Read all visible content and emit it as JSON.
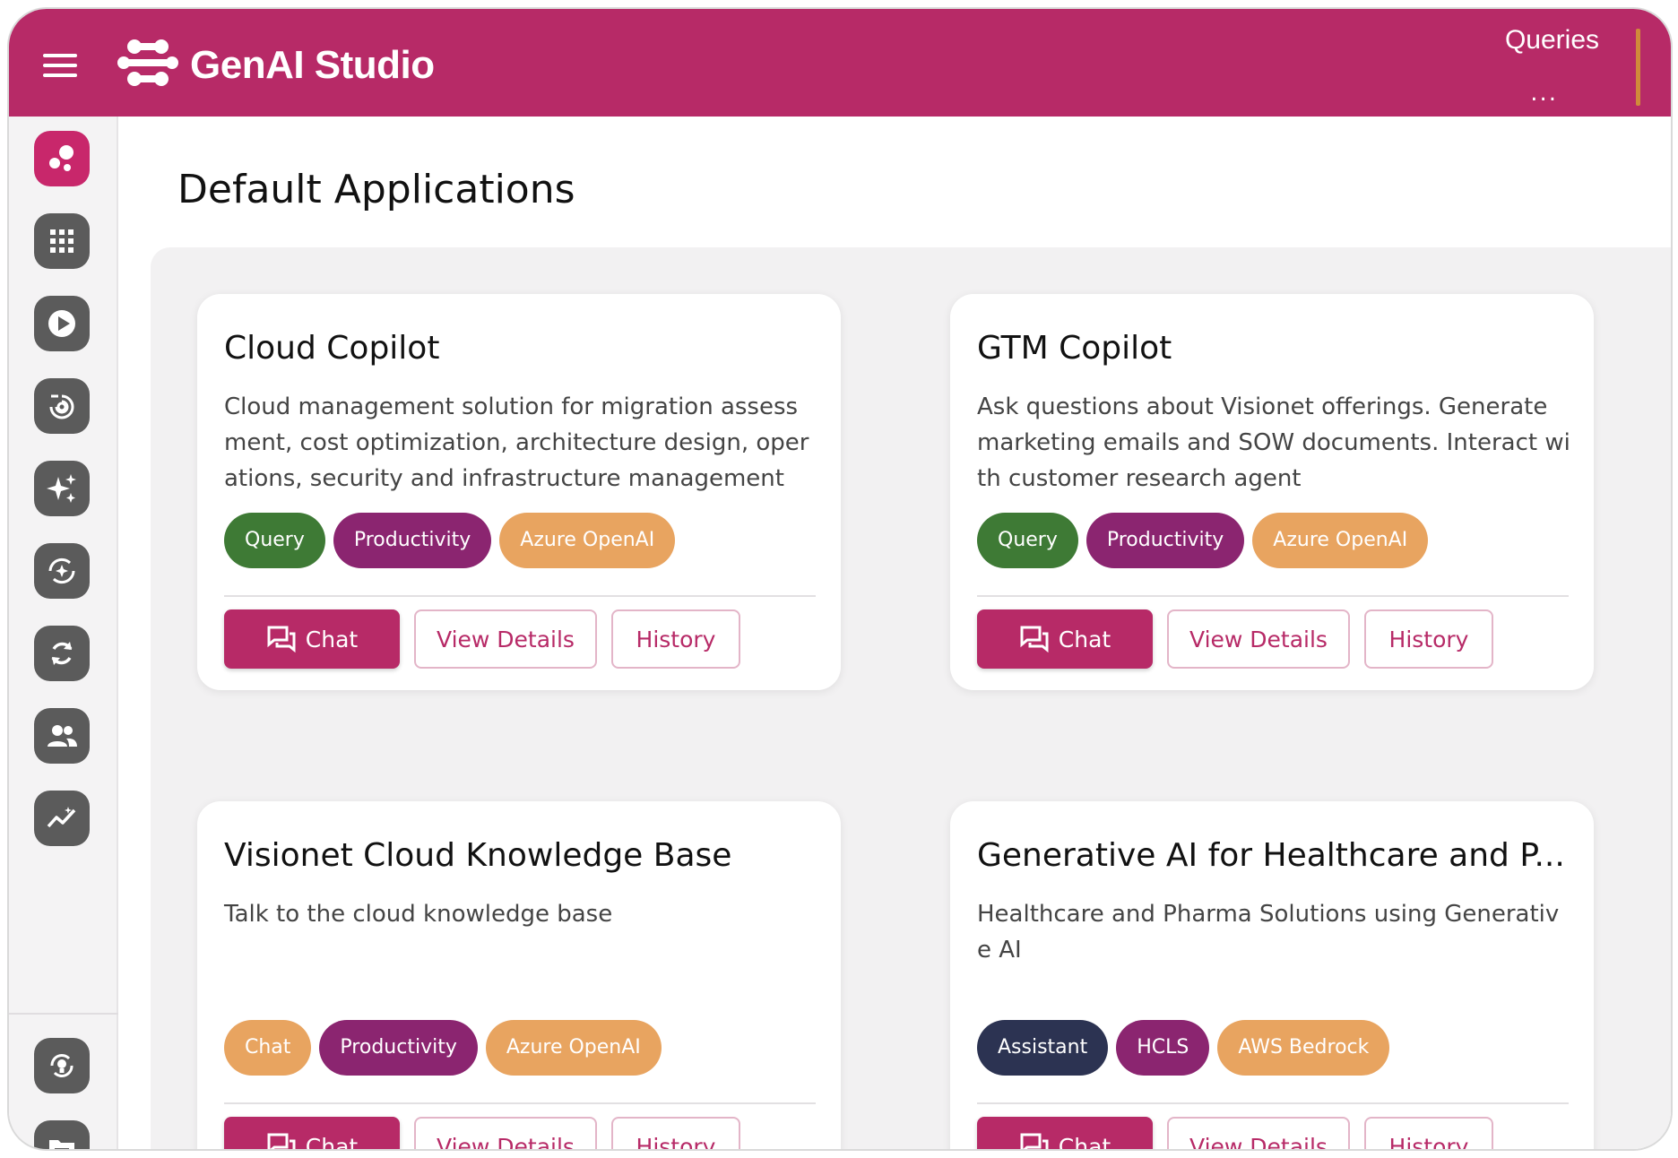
{
  "app": {
    "brand": "GenAI Studio",
    "header_right_title": "Queries",
    "header_right_more": "...",
    "colors": {
      "brand": "#b72a67",
      "tag_green": "#3e7a35",
      "tag_purple": "#8b2570",
      "tag_orange": "#e8a460",
      "tag_navy": "#2c3352"
    }
  },
  "sidebar": {
    "items": [
      {
        "icon": "bubbles-icon",
        "active": true
      },
      {
        "icon": "apps-grid-icon"
      },
      {
        "icon": "play-icon"
      },
      {
        "icon": "spiral-icon"
      },
      {
        "icon": "sparkles-icon"
      },
      {
        "icon": "refresh-sparkle-icon"
      },
      {
        "icon": "sync-icon"
      },
      {
        "icon": "people-icon"
      },
      {
        "icon": "analytics-icon"
      }
    ],
    "bottom_items": [
      {
        "icon": "lightbulb-cycle-icon"
      },
      {
        "icon": "folder-icon"
      }
    ]
  },
  "main": {
    "title": "Default Applications",
    "buttons": {
      "chat": "Chat",
      "details": "View Details",
      "history": "History"
    },
    "cards": [
      {
        "title": "Cloud Copilot",
        "description": "Cloud management solution for migration assessment, cost optimization, architecture design, operations, security and infrastructure management",
        "tags": [
          {
            "label": "Query",
            "color": "#3e7a35"
          },
          {
            "label": "Productivity",
            "color": "#8b2570"
          },
          {
            "label": "Azure OpenAI",
            "color": "#e8a460"
          }
        ]
      },
      {
        "title": "GTM Copilot",
        "description": "Ask questions about Visionet offerings. Generate marketing emails and SOW documents. Interact with customer research agent",
        "tags": [
          {
            "label": "Query",
            "color": "#3e7a35"
          },
          {
            "label": "Productivity",
            "color": "#8b2570"
          },
          {
            "label": "Azure OpenAI",
            "color": "#e8a460"
          }
        ]
      },
      {
        "title": "Visionet Cloud Knowledge Base",
        "description": "Talk to the cloud knowledge base",
        "tags": [
          {
            "label": "Chat",
            "color": "#e8a460"
          },
          {
            "label": "Productivity",
            "color": "#8b2570"
          },
          {
            "label": "Azure OpenAI",
            "color": "#e8a460"
          }
        ]
      },
      {
        "title": "Generative AI for Healthcare and P...",
        "description": "Healthcare and Pharma Solutions using Generative AI",
        "tags": [
          {
            "label": "Assistant",
            "color": "#2c3352"
          },
          {
            "label": "HCLS",
            "color": "#8b2570"
          },
          {
            "label": "AWS Bedrock",
            "color": "#e8a460"
          }
        ]
      }
    ]
  }
}
